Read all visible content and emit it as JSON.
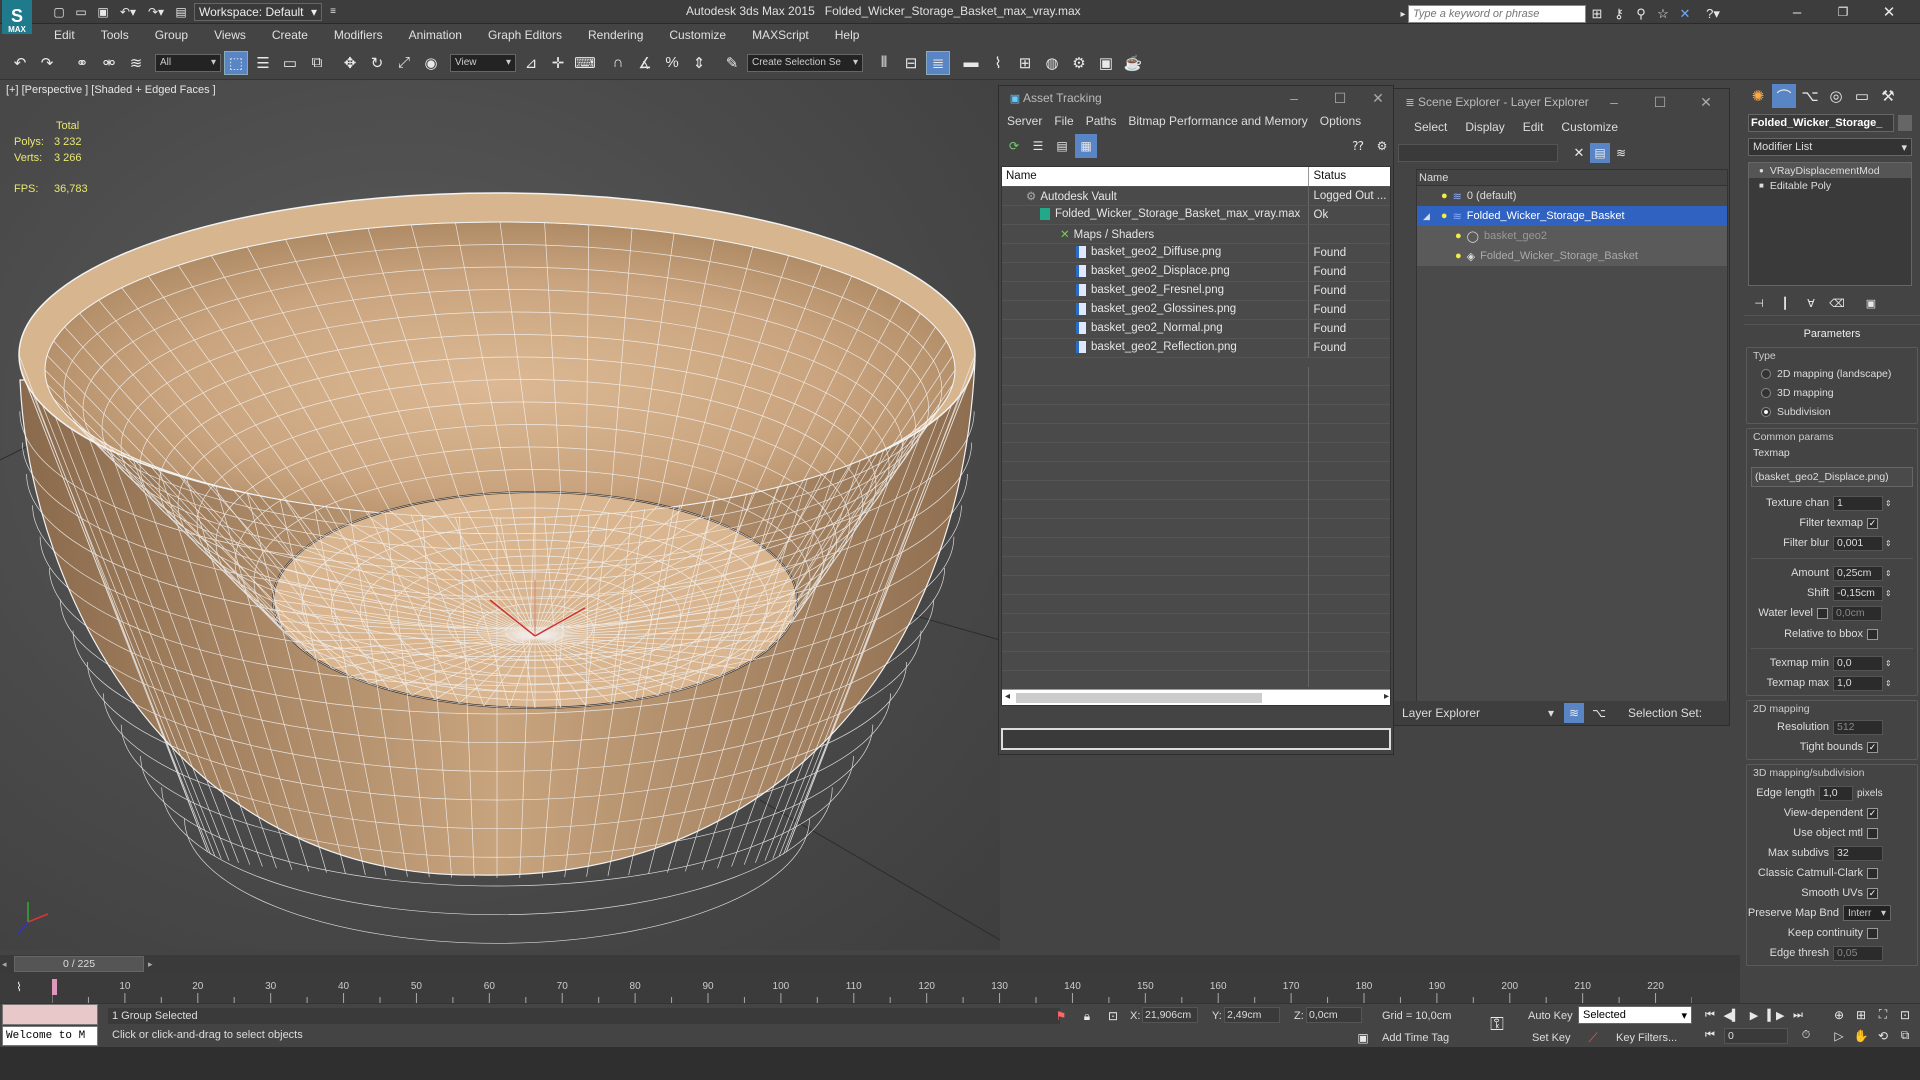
{
  "app": {
    "title": "Autodesk 3ds Max  2015",
    "filename": "Folded_Wicker_Storage_Basket_max_vray.max",
    "workspace": "Workspace: Default",
    "logo": "MAX",
    "search_placeholder": "Type a keyword or phrase"
  },
  "menu": [
    "Edit",
    "Tools",
    "Group",
    "Views",
    "Create",
    "Modifiers",
    "Animation",
    "Graph Editors",
    "Rendering",
    "Customize",
    "MAXScript",
    "Help"
  ],
  "toolbar": {
    "filter_value": "All",
    "ref_coord": "View",
    "selection_set_placeholder": "Create Selection Se"
  },
  "viewport": {
    "label": "[+] [Perspective ] [Shaded + Edged Faces ]",
    "stats_header": "Total",
    "polys_label": "Polys:",
    "polys_value": "3 232",
    "verts_label": "Verts:",
    "verts_value": "3 266",
    "fps_label": "FPS:",
    "fps_value": "36,783"
  },
  "asset_tracking": {
    "title": "Asset Tracking",
    "menu": [
      "Server",
      "File",
      "Paths",
      "Bitmap Performance and Memory",
      "Options"
    ],
    "col_name": "Name",
    "col_status": "Status",
    "rows": [
      {
        "name": "Autodesk Vault",
        "status": "Logged Out ..."
      },
      {
        "name": "Folded_Wicker_Storage_Basket_max_vray.max",
        "status": "Ok"
      },
      {
        "name": "Maps / Shaders",
        "status": ""
      },
      {
        "name": "basket_geo2_Diffuse.png",
        "status": "Found"
      },
      {
        "name": "basket_geo2_Displace.png",
        "status": "Found"
      },
      {
        "name": "basket_geo2_Fresnel.png",
        "status": "Found"
      },
      {
        "name": "basket_geo2_Glossines.png",
        "status": "Found"
      },
      {
        "name": "basket_geo2_Normal.png",
        "status": "Found"
      },
      {
        "name": "basket_geo2_Reflection.png",
        "status": "Found"
      }
    ]
  },
  "scene_explorer": {
    "title": "Scene Explorer - Layer Explorer",
    "menu": [
      "Select",
      "Display",
      "Edit",
      "Customize"
    ],
    "col_name": "Name",
    "items": [
      {
        "name": "0 (default)"
      },
      {
        "name": "Folded_Wicker_Storage_Basket"
      },
      {
        "name": "basket_geo2"
      },
      {
        "name": "Folded_Wicker_Storage_Basket"
      }
    ],
    "footer_label": "Layer Explorer",
    "selection_set_label": "Selection Set:"
  },
  "command_panel": {
    "object_name": "Folded_Wicker_Storage_",
    "modifier_list": "Modifier List",
    "stack": [
      "VRayDisplacementMod",
      "Editable Poly"
    ],
    "rollout_title": "Parameters",
    "type_label": "Type",
    "type_options": [
      "2D mapping (landscape)",
      "3D mapping",
      "Subdivision"
    ],
    "common_params": "Common params",
    "texmap_label": "Texmap",
    "texmap_value": "(basket_geo2_Displace.png)",
    "texture_chan_label": "Texture chan",
    "texture_chan_value": "1",
    "filter_texmap_label": "Filter texmap",
    "filter_blur_label": "Filter blur",
    "filter_blur_value": "0,001",
    "amount_label": "Amount",
    "amount_value": "0,25cm",
    "shift_label": "Shift",
    "shift_value": "-0,15cm",
    "water_level_label": "Water level",
    "water_level_value": "0,0cm",
    "relative_bbox_label": "Relative to bbox",
    "texmap_min_label": "Texmap min",
    "texmap_min_value": "0,0",
    "texmap_max_label": "Texmap max",
    "texmap_max_value": "1,0",
    "mapping2d_label": "2D mapping",
    "resolution_label": "Resolution",
    "resolution_value": "512",
    "tight_bounds_label": "Tight bounds",
    "mapping3d_label": "3D mapping/subdivision",
    "edge_length_label": "Edge length",
    "edge_length_value": "1,0",
    "pixels_label": "pixels",
    "view_dependent_label": "View-dependent",
    "use_object_mtl_label": "Use object mtl",
    "max_subdivs_label": "Max subdivs",
    "max_subdivs_value": "32",
    "classic_cc_label": "Classic Catmull-Clark",
    "smooth_uvs_label": "Smooth UVs",
    "preserve_map_label": "Preserve Map Bnd",
    "preserve_map_value": "Interr",
    "keep_continuity_label": "Keep continuity",
    "edge_thresh_label": "Edge thresh",
    "edge_thresh_value": "0,05"
  },
  "timeline": {
    "frame": "0 / 225",
    "ticks": [
      "10",
      "20",
      "30",
      "40",
      "50",
      "60",
      "70",
      "80",
      "90",
      "100",
      "110",
      "120",
      "130",
      "140",
      "150",
      "160",
      "170",
      "180",
      "190",
      "200",
      "210",
      "220"
    ]
  },
  "status": {
    "welcome": "Welcome to M",
    "selected": "1 Group Selected",
    "prompt": "Click or click-and-drag to select objects",
    "x_label": "X:",
    "x_value": "21,906cm",
    "y_label": "Y:",
    "y_value": "2,49cm",
    "z_label": "Z:",
    "z_value": "0,0cm",
    "grid": "Grid = 10,0cm",
    "add_time_tag": "Add Time Tag",
    "auto_key": "Auto Key",
    "set_key": "Set Key",
    "key_mode_value": "Selected",
    "key_filters": "Key Filters...",
    "frame_value": "0"
  }
}
